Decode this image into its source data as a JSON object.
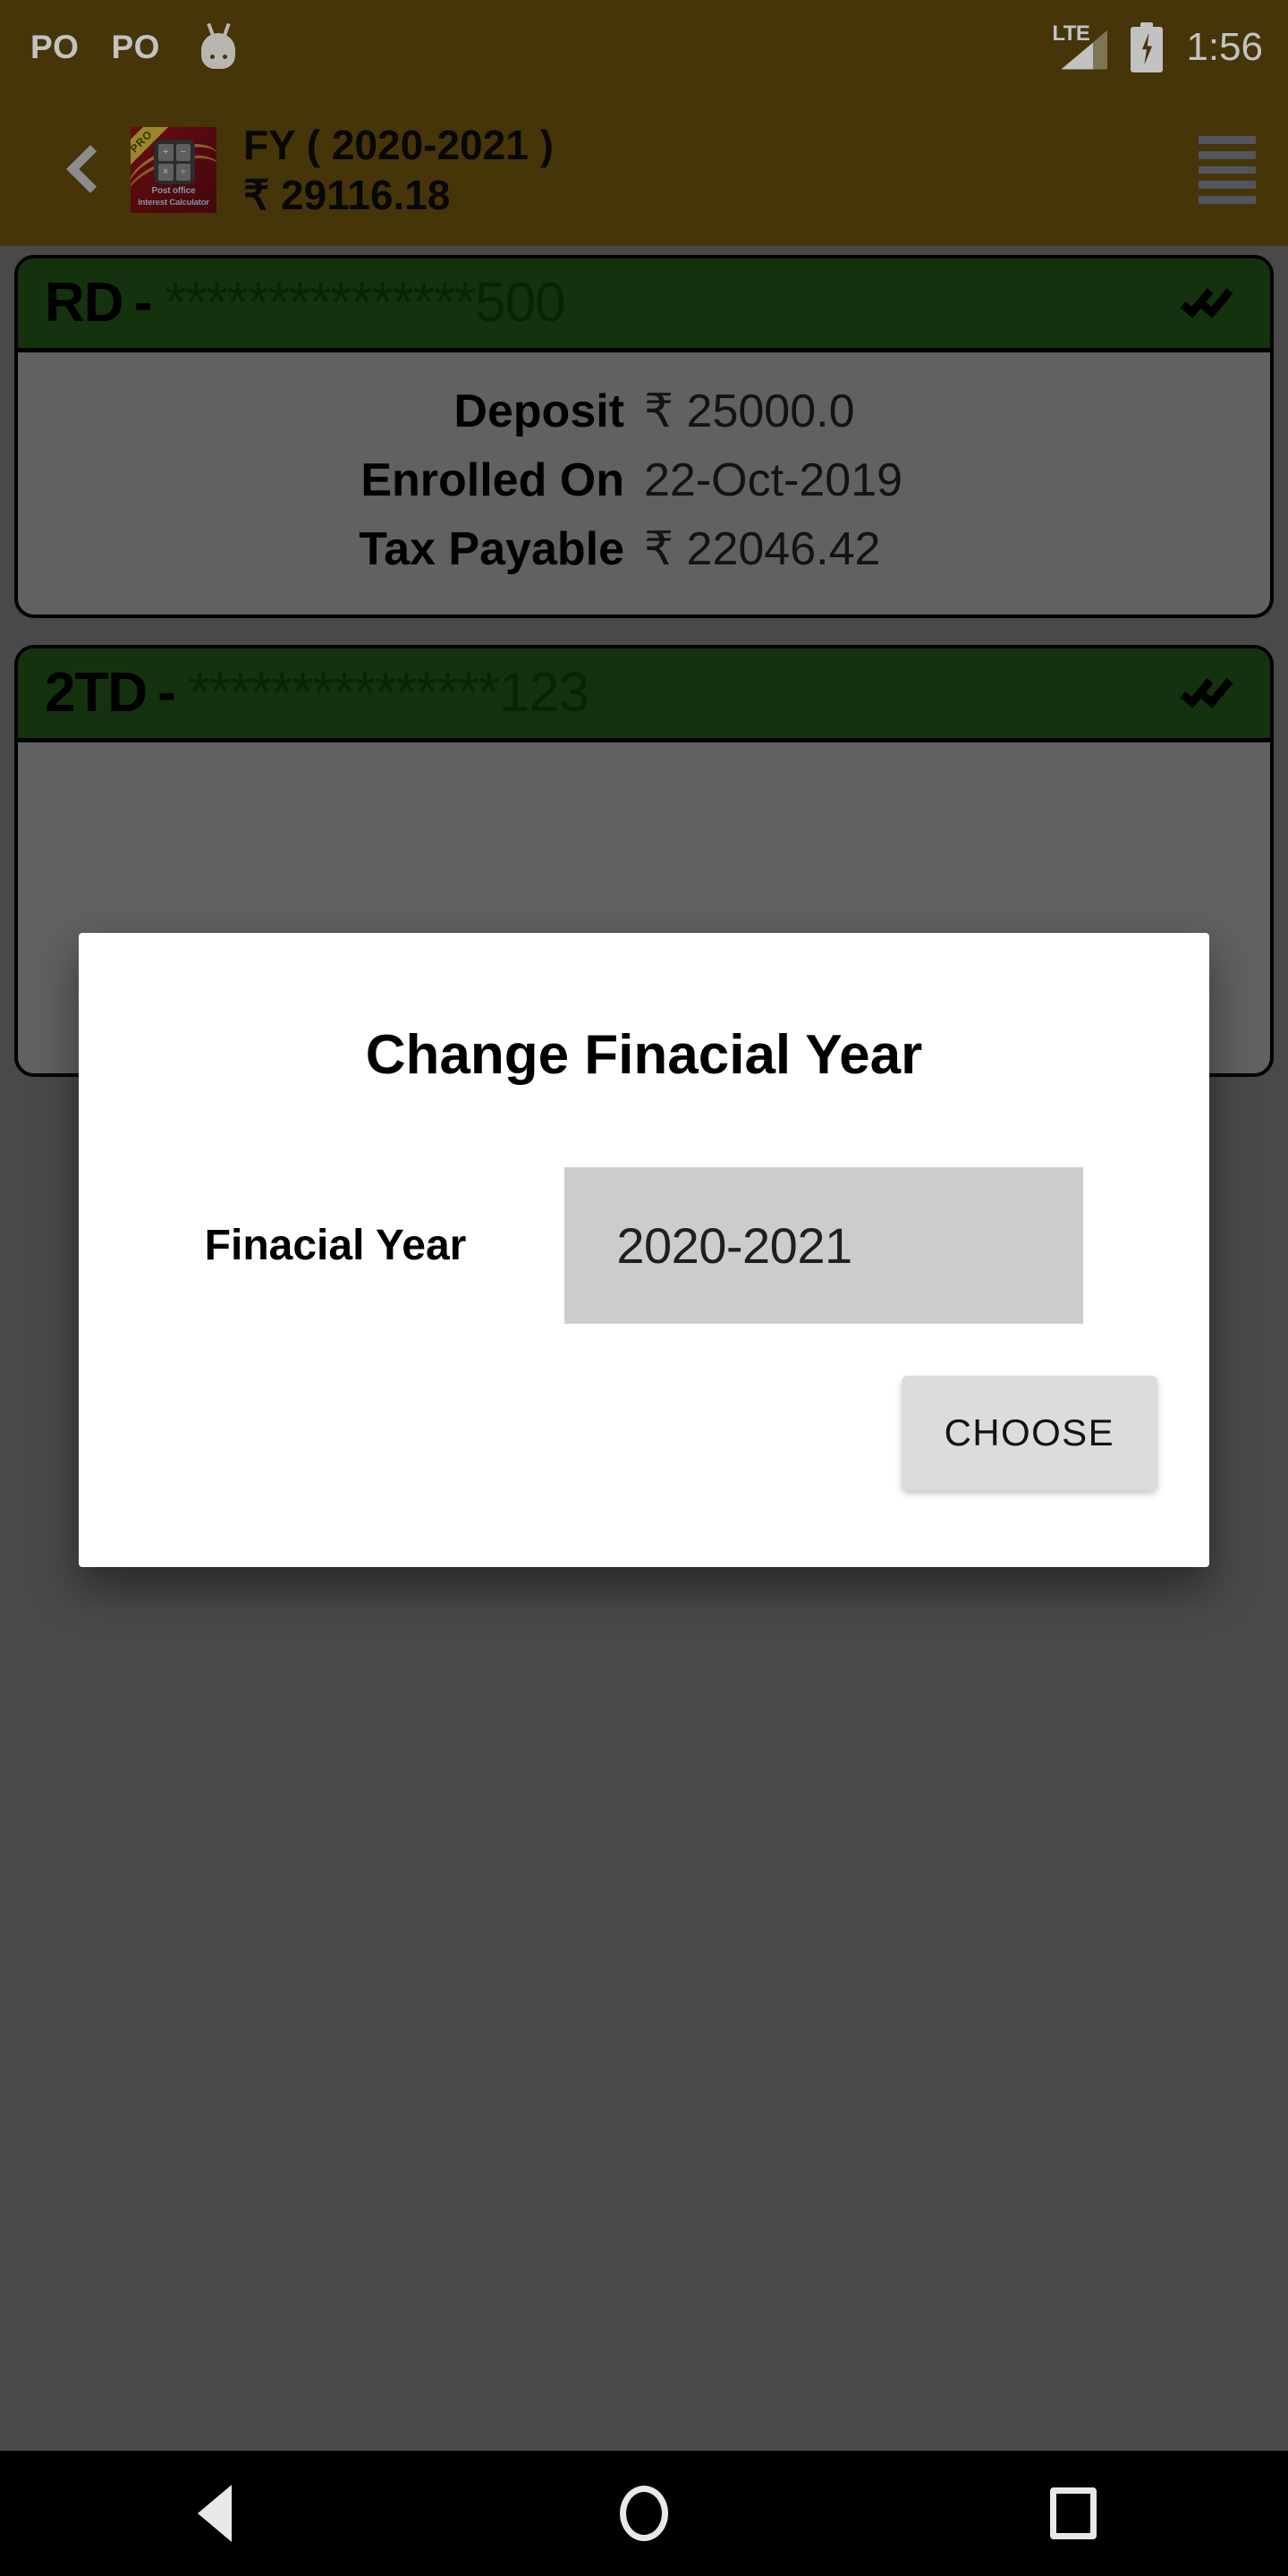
{
  "status_bar": {
    "notification_labels": [
      "PO",
      "PO"
    ],
    "mascot_icon": "android-mascot-icon",
    "network_label": "LTE",
    "signal_icon": "signal-bars-icon",
    "battery_icon": "battery-charging-icon",
    "clock": "1:56",
    "background_color": "#5C460C"
  },
  "app_bar": {
    "back_icon": "back-chevron-icon",
    "app_icon": {
      "name": "post-office-interest-calculator-icon",
      "badge": "PRO",
      "label_line1": "Post office",
      "label_line2": "Interest Calculator",
      "keys": [
        "+",
        "−",
        "×",
        "÷"
      ]
    },
    "title": "FY ( 2020-2021 )",
    "subtitle": "₹ 29116.18",
    "menu_icon": "hamburger-menu-icon",
    "background_color": "#5C460C"
  },
  "accounts": [
    {
      "type": "RD",
      "separator": "-",
      "masked_number": "***************500",
      "status_icon": "double-check-icon",
      "header_color": "#1B4212",
      "rows": [
        {
          "label": "Deposit",
          "value": "₹ 25000.0"
        },
        {
          "label": "Enrolled On",
          "value": "22-Oct-2019"
        },
        {
          "label": "Tax Payable",
          "value": "₹ 22046.42"
        }
      ]
    },
    {
      "type": "2TD",
      "separator": "-",
      "masked_number": "***************123",
      "status_icon": "double-check-icon",
      "header_color": "#1B4212",
      "rows": []
    }
  ],
  "dialog": {
    "title": "Change Finacial Year",
    "field_label": "Finacial Year",
    "spinner_value": "2020-2021",
    "spinner_icon": "dropdown-spinner",
    "choose_button": "CHOOSE"
  },
  "nav_bar": {
    "back_icon": "nav-back-icon",
    "home_icon": "nav-home-icon",
    "recents_icon": "nav-recents-icon",
    "background_color": "#000000"
  }
}
